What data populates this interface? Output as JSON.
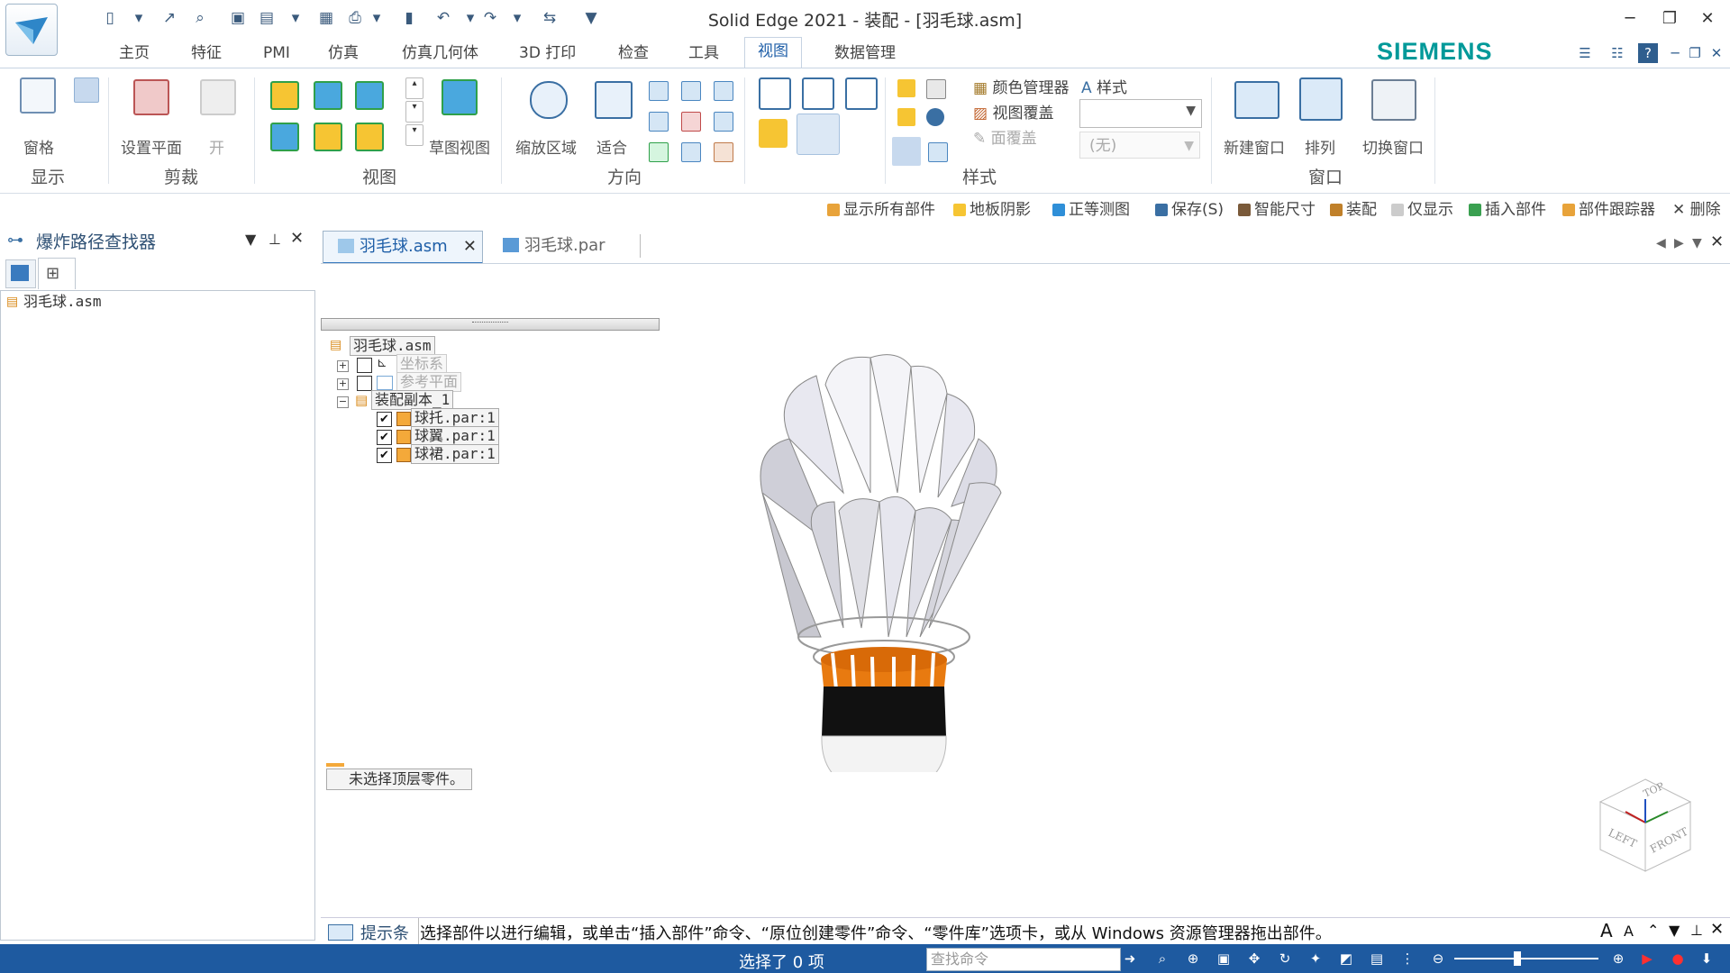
{
  "window": {
    "title": "Solid Edge 2021 - 装配 - [羽毛球.asm]"
  },
  "brand": "SIEMENS",
  "tabs": [
    "主页",
    "特征",
    "PMI",
    "仿真",
    "仿真几何体",
    "3D 打印",
    "检查",
    "工具",
    "视图",
    "数据管理"
  ],
  "active_tab": "视图",
  "ribbon": {
    "groups": {
      "display": "显示",
      "clip": "剪裁",
      "views": "视图",
      "orient": "方向",
      "style": "样式",
      "window": "窗口"
    },
    "buttons": {
      "panes": "窗格",
      "set_plane": "设置平面",
      "on": "开",
      "sketch_view": "草图视图",
      "zoom_area": "缩放区域",
      "fit": "适合",
      "color_manager": "颜色管理器",
      "view_overrides": "视图覆盖",
      "face_overrides": "面覆盖",
      "styles": "样式",
      "style_value": "(无)",
      "new_window": "新建窗口",
      "arrange": "排列",
      "switch_window": "切换窗口"
    }
  },
  "quick_commands": [
    "显示所有部件",
    "地板阴影",
    "正等测图",
    "保存(S)",
    "智能尺寸",
    "装配",
    "仅显示",
    "插入部件",
    "部件跟踪器",
    "删除"
  ],
  "left_pane": {
    "title": "爆炸路径查找器",
    "tree": [
      "羽毛球.asm"
    ]
  },
  "doc_tabs": [
    {
      "label": "羽毛球.asm",
      "active": true
    },
    {
      "label": "羽毛球.par",
      "active": false
    }
  ],
  "pathfinder": {
    "root": "羽毛球.asm",
    "nodes": [
      {
        "label": "坐标系",
        "dim": true,
        "checked": false
      },
      {
        "label": "参考平面",
        "dim": true,
        "checked": false
      },
      {
        "label": "装配副本_1",
        "dim": false
      }
    ],
    "parts": [
      {
        "label": "球托.par:1",
        "checked": true
      },
      {
        "label": "球翼.par:1",
        "checked": true
      },
      {
        "label": "球裙.par:1",
        "checked": true
      }
    ],
    "message": "未选择顶层零件。"
  },
  "view_cube": {
    "top": "TOP",
    "left": "LEFT",
    "front": "FRONT"
  },
  "prompt": {
    "label": "提示条",
    "text": "选择部件以进行编辑，或单击“插入部件”命令、“原位创建零件”命令、“零件库”选项卡，或从 Windows 资源管理器拖出部件。"
  },
  "status": {
    "selection": "选择了 0 项",
    "find_placeholder": "查找命令"
  },
  "colors": {
    "accent": "#1e5aa0",
    "brand": "#009999",
    "orange": "#e87a10"
  }
}
